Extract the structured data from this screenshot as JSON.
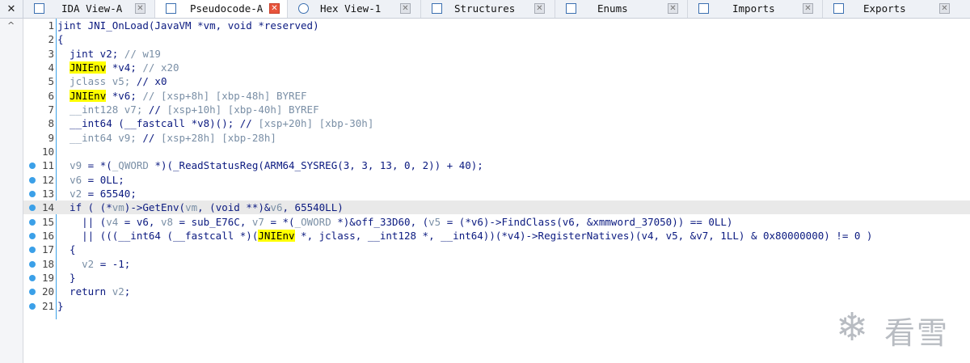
{
  "tabs": [
    {
      "label": "IDA View-A",
      "icon": "ida-view-icon",
      "active": false
    },
    {
      "label": "Pseudocode-A",
      "icon": "pseudocode-icon",
      "active": true
    },
    {
      "label": "Hex View-1",
      "icon": "hex-view-icon",
      "active": false
    },
    {
      "label": "Structures",
      "icon": "structures-icon",
      "active": false
    },
    {
      "label": "Enums",
      "icon": "enums-icon",
      "active": false
    },
    {
      "label": "Imports",
      "icon": "imports-icon",
      "active": false
    },
    {
      "label": "Exports",
      "icon": "exports-icon",
      "active": false
    }
  ],
  "close_all_glyph": "✕",
  "scroll_up_glyph": "^",
  "code": {
    "line_numbers": [
      "1",
      "2",
      "3",
      "4",
      "5",
      "6",
      "7",
      "8",
      "9",
      "10",
      "11",
      "12",
      "13",
      "14",
      "15",
      "16",
      "17",
      "18",
      "19",
      "20",
      "21"
    ],
    "highlighted_line": "14",
    "breakpoint_lines": [
      "11",
      "12",
      "13",
      "14",
      "15",
      "16",
      "17",
      "18",
      "19",
      "20",
      "21"
    ]
  },
  "watermark": {
    "text": "看雪"
  },
  "colors": {
    "breakpoint": "#3ba0e8",
    "highlight": "#ffff00",
    "code_text": "#0b1a80",
    "comment": "#7a8fa6",
    "current_line": "#e9e9e9"
  }
}
